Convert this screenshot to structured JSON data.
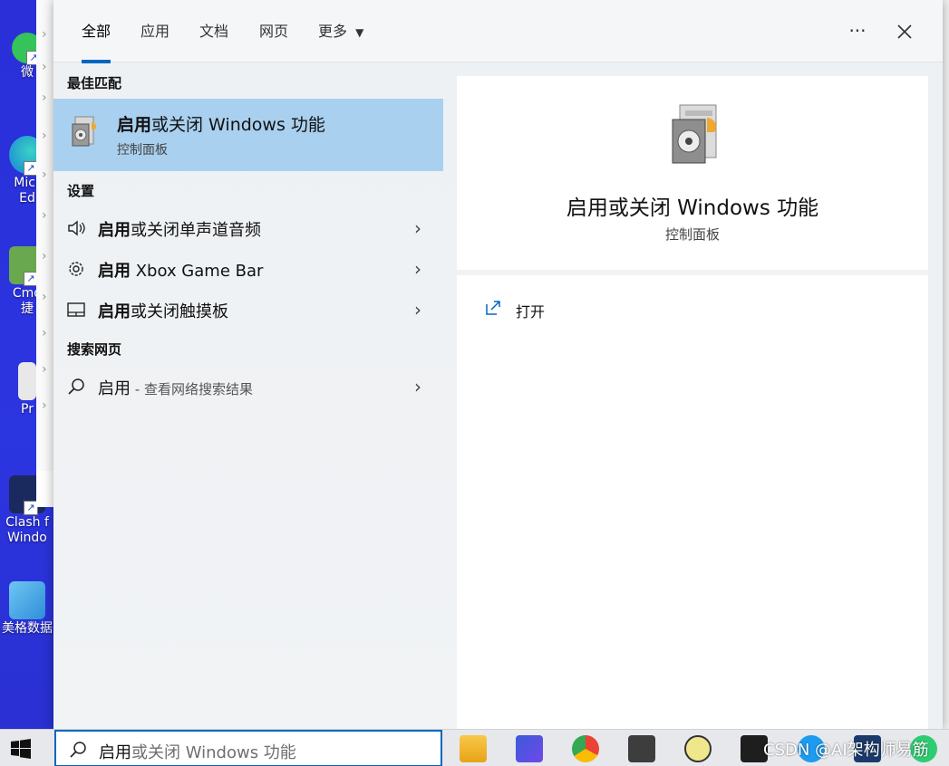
{
  "tabs": [
    "全部",
    "应用",
    "文档",
    "网页",
    "更多"
  ],
  "header": {
    "more_options": "···",
    "close": "✕"
  },
  "best_match": {
    "section": "最佳匹配",
    "title_bold": "启用",
    "title_rest": "或关闭 Windows 功能",
    "subtitle": "控制面板"
  },
  "settings": {
    "section": "设置",
    "items": [
      {
        "bold": "启用",
        "rest": "或关闭单声道音频",
        "icon": "speaker-icon"
      },
      {
        "bold": "启用",
        "rest": " Xbox Game Bar",
        "icon": "gear-icon"
      },
      {
        "bold": "启用",
        "rest": "或关闭触摸板",
        "icon": "touchpad-icon"
      }
    ]
  },
  "web": {
    "section": "搜索网页",
    "query": "启用",
    "suffix": " - 查看网络搜索结果"
  },
  "detail": {
    "title": "启用或关闭 Windows 功能",
    "subtitle": "控制面板",
    "action_label": "打开"
  },
  "taskbar": {
    "search_typed": "启用",
    "search_suggest": "或关闭 Windows 功能"
  },
  "desktop_icons": [
    "微",
    "Micr\nEd",
    "Cmd\n捷",
    "Pr",
    "Clash f\nWindo",
    "美格数据"
  ],
  "watermark": "CSDN @AI架构师易筋",
  "colors": {
    "accent": "#0067c0",
    "highlight": "#a9d0ef"
  }
}
